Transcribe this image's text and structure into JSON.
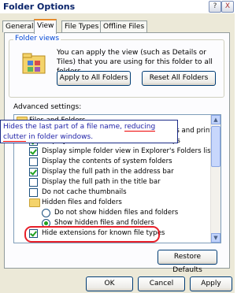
{
  "window": {
    "title": "Folder Options",
    "help_label": "?",
    "close_label": "X"
  },
  "tabs": [
    {
      "label": "General"
    },
    {
      "label": "View"
    },
    {
      "label": "File Types"
    },
    {
      "label": "Offline Files"
    }
  ],
  "folder_views": {
    "group_label": "Folder views",
    "description": "You can apply the view (such as Details or Tiles) that you are using for this folder to all folders.",
    "apply_all_label": "Apply to All Folders",
    "reset_all_label": "Reset All Folders"
  },
  "advanced": {
    "label": "Advanced settings:",
    "items": [
      {
        "type": "folder",
        "label": "Files and Folders"
      },
      {
        "type": "checkbox",
        "checked": false,
        "label": "Automatically search for network folders and printers"
      },
      {
        "type": "checkbox",
        "checked": true,
        "label": "Display file size information in folder tips"
      },
      {
        "type": "checkbox",
        "checked": true,
        "label": "Display simple folder view in Explorer's Folders list"
      },
      {
        "type": "checkbox",
        "checked": false,
        "label": "Display the contents of system folders"
      },
      {
        "type": "checkbox",
        "checked": true,
        "label": "Display the full path in the address bar"
      },
      {
        "type": "checkbox",
        "checked": false,
        "label": "Display the full path in the title bar"
      },
      {
        "type": "checkbox",
        "checked": false,
        "label": "Do not cache thumbnails"
      },
      {
        "type": "folder",
        "label": "Hidden files and folders"
      },
      {
        "type": "radio",
        "checked": false,
        "label": "Do not show hidden files and folders"
      },
      {
        "type": "radio",
        "checked": true,
        "label": "Show hidden files and folders"
      },
      {
        "type": "checkbox",
        "checked": true,
        "label": "Hide extensions for known file types"
      }
    ]
  },
  "tooltip": {
    "text_before": "Hides the last part of a file name, ",
    "text_highlight": "reducing clutter",
    "text_after": " in folder windows."
  },
  "buttons": {
    "restore_defaults": "Restore Defaults",
    "ok": "OK",
    "cancel": "Cancel",
    "apply": "Apply"
  }
}
